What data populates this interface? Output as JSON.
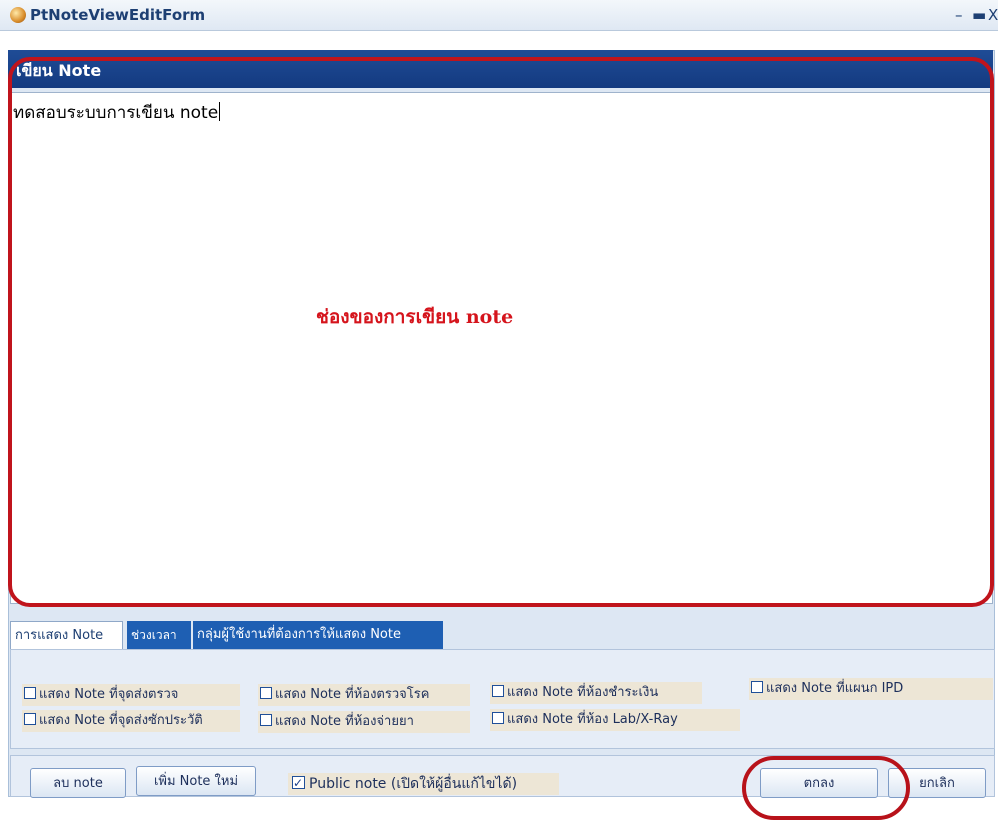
{
  "window": {
    "title": "PtNoteViewEditForm",
    "minimize_glyph": "–",
    "maximize_glyph": "▬",
    "close_glyph": "X"
  },
  "panel": {
    "header": "เขียน Note"
  },
  "editor": {
    "text": "ทดสอบระบบการเขียน note"
  },
  "annotation": {
    "label": "ช่องของการเขียน note",
    "color": "#d5141c"
  },
  "tabs": [
    {
      "label": "การแสดง Note"
    },
    {
      "label": "ช่วงเวลา"
    },
    {
      "label": "กลุ่มผู้ใช้งานที่ต้องการให้แสดง Note"
    }
  ],
  "options": [
    {
      "label": "แสดง Note ที่จุดส่งตรวจ",
      "checked": false
    },
    {
      "label": "แสดง Note ที่ห้องตรวจโรค",
      "checked": false
    },
    {
      "label": "แสดง Note ที่ห้องชำระเงิน",
      "checked": false
    },
    {
      "label": "แสดง Note ที่แผนก IPD",
      "checked": false
    },
    {
      "label": "แสดง Note ที่จุดส่งซักประวัติ",
      "checked": false
    },
    {
      "label": "แสดง Note ที่ห้องจ่ายยา",
      "checked": false
    },
    {
      "label": "แสดง Note ที่ห้อง Lab/X-Ray",
      "checked": false
    }
  ],
  "buttons": {
    "delete": "ลบ note",
    "add": "เพิ่ม Note ใหม่",
    "ok": "ตกลง",
    "cancel": "ยกเลิก"
  },
  "public_note": {
    "label": "Public note (เปิดให้ผู้อื่นแก้ไขได้)",
    "checked": true
  },
  "colors": {
    "header_bg": "#1f4c96",
    "active_tab_bg": "#1e5fb3",
    "callout": "#c0141c"
  }
}
